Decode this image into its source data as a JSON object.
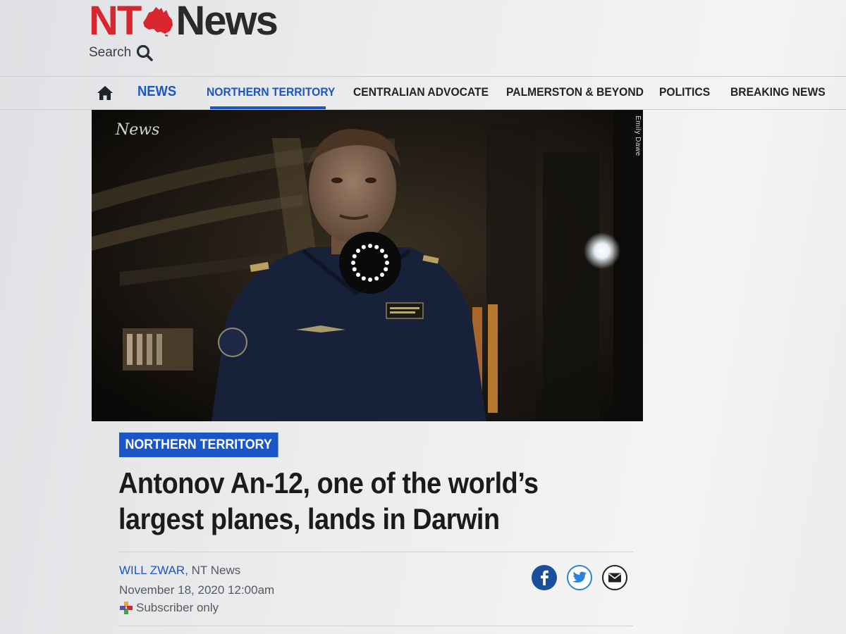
{
  "masthead": {
    "logo_left": "NT",
    "logo_right": "News",
    "search_label": "Search"
  },
  "nav": {
    "items": [
      {
        "label": "NEWS"
      },
      {
        "label": "NORTHERN TERRITORY"
      },
      {
        "label": "CENTRALIAN ADVOCATE"
      },
      {
        "label": "PALMERSTON & BEYOND"
      },
      {
        "label": "POLITICS"
      },
      {
        "label": "BREAKING NEWS"
      }
    ],
    "active": "NORTHERN TERRITORY"
  },
  "video": {
    "brand": "News",
    "credit": "Emily Dawe"
  },
  "article": {
    "category": "NORTHERN TERRITORY",
    "headline": "Antonov An-12, one of the world’s largest planes, lands in Darwin",
    "author": "WILL ZWAR",
    "publication": ", NT News",
    "date": "November 18, 2020 12:00am",
    "access": "Subscriber only"
  },
  "share": {
    "icons": [
      "facebook-icon",
      "twitter-icon",
      "email-icon"
    ]
  },
  "colors": {
    "brand_red": "#d8262e",
    "accent_blue": "#1a56c7",
    "text_dark": "#1a1b1d",
    "facebook": "#1a4f9e",
    "twitter": "#2a83d4"
  }
}
